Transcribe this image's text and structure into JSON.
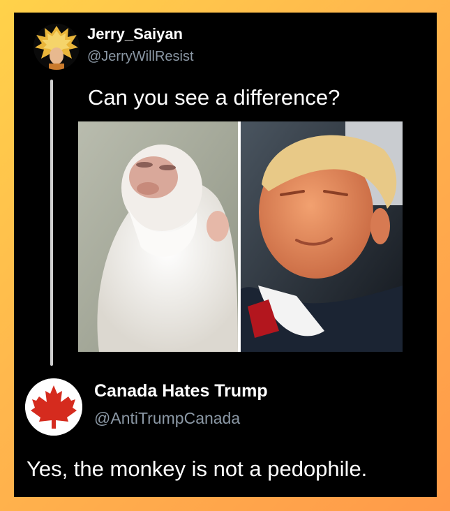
{
  "tweet1": {
    "display_name": "Jerry_Saiyan",
    "handle": "@JerryWillResist",
    "text": "Can you see a difference?",
    "avatar_icon": "saiyan-avatar-icon",
    "media": [
      "monkey-photo",
      "man-photo"
    ]
  },
  "tweet2": {
    "display_name": "Canada Hates Trump",
    "handle": "@AntiTrumpCanada",
    "text": "Yes, the monkey is not a pedophile.",
    "avatar_icon": "maple-leaf-icon"
  },
  "colors": {
    "card_bg": "#000000",
    "handle_gray": "#8b98a5",
    "maple_red": "#d52b1e",
    "frame_gradient": [
      "#ffd24a",
      "#ff9a4a"
    ]
  }
}
